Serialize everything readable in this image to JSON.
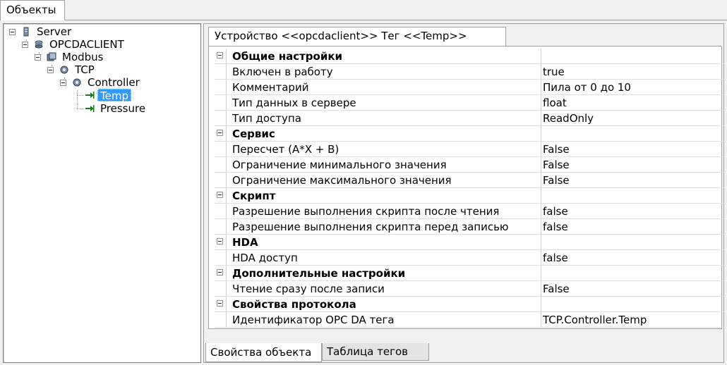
{
  "top_tab": {
    "label": "Объекты"
  },
  "tree": {
    "server": "Server",
    "opc": "OPCDACLIENT",
    "modbus": "Modbus",
    "tcp": "TCP",
    "controller": "Controller",
    "temp": "Temp",
    "pressure": "Pressure",
    "icons": {
      "server": "server-icon",
      "opc": "opc-client-icon",
      "modbus": "modbus-icon",
      "tcp": "tcp-icon",
      "controller": "controller-icon",
      "tag": "tag-arrow-icon"
    },
    "colors": {
      "selected": "#3399ff",
      "tag_arrow": "#1a7a1a"
    }
  },
  "inner_tab": {
    "label": "Устройство <<opcdaclient>> Тег  <<Temp>>"
  },
  "grid": {
    "rows": [
      {
        "name": "Общие настройки",
        "value": "",
        "category": true
      },
      {
        "name": "Включен в работу",
        "value": "true"
      },
      {
        "name": "Комментарий",
        "value": "Пила от 0 до 10"
      },
      {
        "name": "Тип данных в сервере",
        "value": "float"
      },
      {
        "name": "Тип доступа",
        "value": "ReadOnly"
      },
      {
        "name": "Сервис",
        "value": "",
        "category": true
      },
      {
        "name": "Пересчет (A*X + B)",
        "value": "False"
      },
      {
        "name": "Ограничение минимального значения",
        "value": "False"
      },
      {
        "name": "Ограничение максимального значения",
        "value": "False"
      },
      {
        "name": "Скрипт",
        "value": "",
        "category": true
      },
      {
        "name": "Разрешение выполнения скрипта после чтения",
        "value": "false"
      },
      {
        "name": "Разрешение выполнения скрипта перед записью",
        "value": "false"
      },
      {
        "name": "HDA",
        "value": "",
        "category": true
      },
      {
        "name": "HDA доступ",
        "value": "false"
      },
      {
        "name": "Дополнительные настройки",
        "value": "",
        "category": true
      },
      {
        "name": "Чтение сразу после записи",
        "value": "False"
      },
      {
        "name": "Свойства протокола",
        "value": "",
        "category": true
      },
      {
        "name": "Идентификатор OPC DA тега",
        "value": "TCP.Controller.Temp"
      }
    ]
  },
  "bottom_tabs": {
    "active": "Свойства объекта",
    "inactive": "Таблица тегов"
  }
}
